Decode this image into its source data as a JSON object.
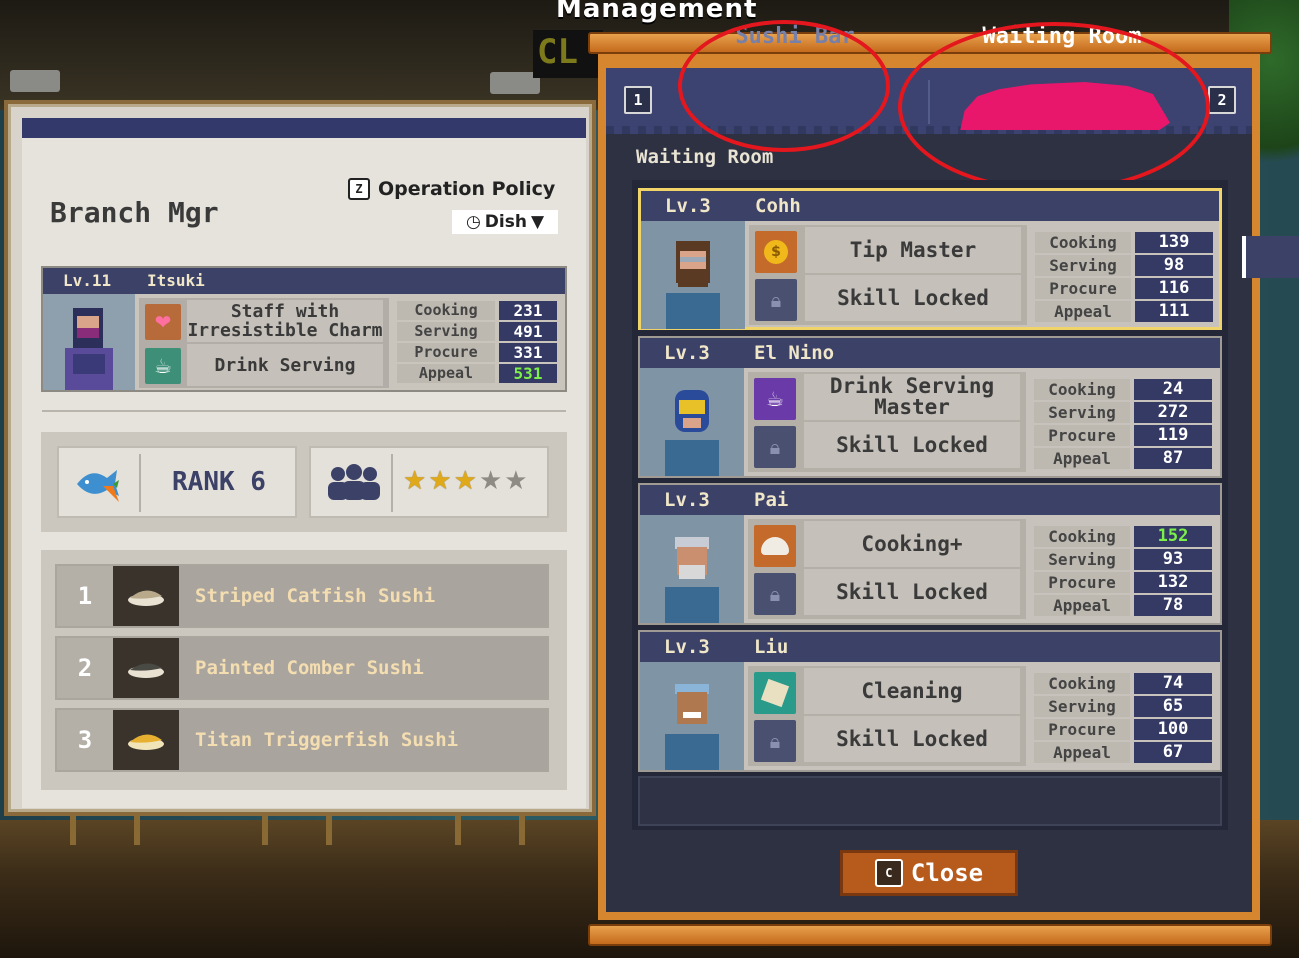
{
  "window_title": "Management",
  "left": {
    "title": "Branch Mgr",
    "operation_policy": {
      "key": "Z",
      "label": "Operation Policy",
      "value": "Dish"
    },
    "manager": {
      "level": "Lv.11",
      "name": "Itsuki",
      "skills": [
        "Staff with Irresistible Charm",
        "Drink Serving"
      ],
      "stats": [
        {
          "label": "Cooking",
          "value": "231"
        },
        {
          "label": "Serving",
          "value": "491"
        },
        {
          "label": "Procure",
          "value": "331"
        },
        {
          "label": "Appeal",
          "value": "531",
          "highlight": true
        }
      ]
    },
    "rank": {
      "label": "RANK 6",
      "stars_filled": 3,
      "stars_total": 5
    },
    "menu": [
      {
        "num": "1",
        "name": "Striped Catfish Sushi"
      },
      {
        "num": "2",
        "name": "Painted Comber Sushi"
      },
      {
        "num": "3",
        "name": "Titan Triggerfish Sushi"
      }
    ]
  },
  "right": {
    "tab_key_left": "1",
    "tab_key_right": "2",
    "tabs": [
      {
        "label": "Sushi Bar",
        "active": false
      },
      {
        "label": "Waiting Room",
        "active": true
      }
    ],
    "section_label": "Waiting Room",
    "staff": [
      {
        "level": "Lv.3",
        "name": "Cohh",
        "selected": true,
        "skills": [
          "Tip Master",
          "Skill Locked"
        ],
        "stats": [
          {
            "label": "Cooking",
            "value": "139"
          },
          {
            "label": "Serving",
            "value": "98"
          },
          {
            "label": "Procure",
            "value": "116"
          },
          {
            "label": "Appeal",
            "value": "111"
          }
        ]
      },
      {
        "level": "Lv.3",
        "name": "El Nino",
        "selected": false,
        "skills": [
          "Drink Serving Master",
          "Skill Locked"
        ],
        "stats": [
          {
            "label": "Cooking",
            "value": "24"
          },
          {
            "label": "Serving",
            "value": "272"
          },
          {
            "label": "Procure",
            "value": "119"
          },
          {
            "label": "Appeal",
            "value": "87"
          }
        ]
      },
      {
        "level": "Lv.3",
        "name": "Pai",
        "selected": false,
        "skills": [
          "Cooking+",
          "Skill Locked"
        ],
        "stats": [
          {
            "label": "Cooking",
            "value": "152",
            "highlight": true
          },
          {
            "label": "Serving",
            "value": "93"
          },
          {
            "label": "Procure",
            "value": "132"
          },
          {
            "label": "Appeal",
            "value": "78"
          }
        ]
      },
      {
        "level": "Lv.3",
        "name": "Liu",
        "selected": false,
        "skills": [
          "Cleaning",
          "Skill Locked"
        ],
        "stats": [
          {
            "label": "Cooking",
            "value": "74"
          },
          {
            "label": "Serving",
            "value": "65"
          },
          {
            "label": "Procure",
            "value": "100"
          },
          {
            "label": "Appeal",
            "value": "67"
          }
        ]
      }
    ],
    "close": {
      "key": "C",
      "label": "Close"
    }
  },
  "colors": {
    "accent_tab": "#e8176b",
    "header_navy": "#3c4168",
    "highlight_green": "#7cf04a",
    "annotation_red": "#e4161e"
  }
}
